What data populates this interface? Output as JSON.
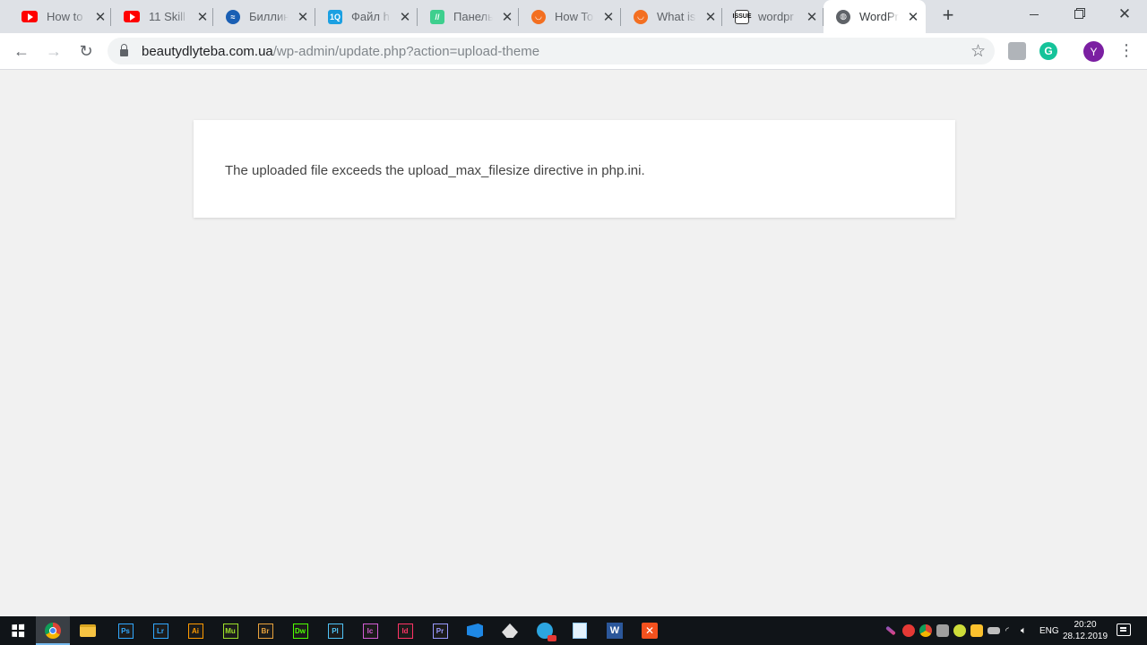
{
  "tabs": [
    {
      "title": "How to",
      "icon": "youtube-icon"
    },
    {
      "title": "11 Skill",
      "icon": "youtube-icon"
    },
    {
      "title": "Биллин",
      "icon": "billing-globe-icon"
    },
    {
      "title": "Файл h",
      "icon": "1q-icon"
    },
    {
      "title": "Панель",
      "icon": "panel-icon"
    },
    {
      "title": "How To",
      "icon": "orange-bucket-icon"
    },
    {
      "title": "What is",
      "icon": "orange-bucket-icon"
    },
    {
      "title": "wordpr",
      "icon": "issuu-icon"
    },
    {
      "title": "WordPr",
      "icon": "globe-icon",
      "active": true
    }
  ],
  "address_bar": {
    "host": "beautydlyteba.com.ua",
    "path": "/wp-admin/update.php?action=upload-theme"
  },
  "profile": {
    "initial": "Y"
  },
  "page": {
    "error_message": "The uploaded file exceeds the upload_max_filesize directive in php.ini."
  },
  "taskbar": {
    "apps": [
      {
        "label": "Ps",
        "color": "#31a8ff",
        "name": "photoshop-icon"
      },
      {
        "label": "Lr",
        "color": "#31a8ff",
        "name": "lightroom-icon"
      },
      {
        "label": "Ai",
        "color": "#ff9a00",
        "name": "illustrator-icon"
      },
      {
        "label": "Mu",
        "color": "#9ce029",
        "name": "muse-icon"
      },
      {
        "label": "Br",
        "color": "#e8a23c",
        "name": "bridge-icon"
      },
      {
        "label": "Dw",
        "color": "#4cff00",
        "name": "dreamweaver-icon"
      },
      {
        "label": "Pl",
        "color": "#4fc3f7",
        "name": "prelude-icon"
      },
      {
        "label": "Ic",
        "color": "#d35cd6",
        "name": "incopy-icon"
      },
      {
        "label": "Id",
        "color": "#ff3366",
        "name": "indesign-icon"
      },
      {
        "label": "Pr",
        "color": "#9999ff",
        "name": "premiere-icon"
      }
    ],
    "language": "ENG",
    "time": "20:20",
    "date": "28.12.2019"
  },
  "colors": {
    "page_bg": "#f1f1f1",
    "tabstrip_bg": "#dee1e6",
    "avatar": "#7b1fa2",
    "taskbar_bg": "#101418"
  }
}
